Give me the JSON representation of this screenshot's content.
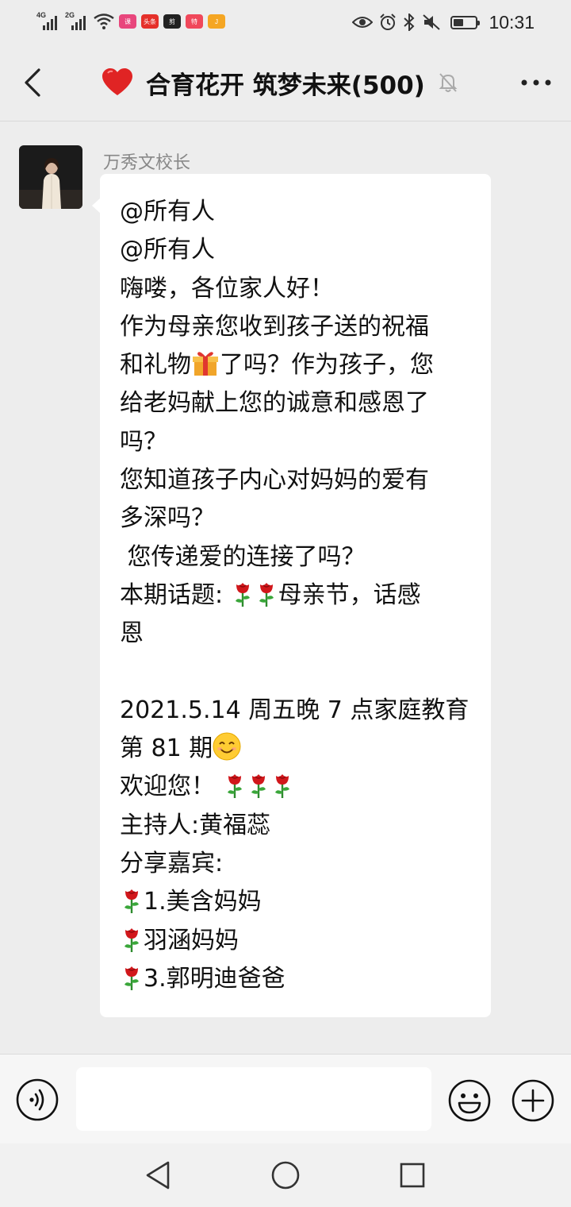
{
  "status_bar": {
    "net1": "4G",
    "net2": "2G",
    "app_badges": [
      {
        "label": "课",
        "color": "#e8467c"
      },
      {
        "label": "头条",
        "color": "#e5302a"
      },
      {
        "label": "剪",
        "color": "#222222"
      },
      {
        "label": "特",
        "color": "#f0485b"
      },
      {
        "label": "J",
        "color": "#f5a623"
      }
    ],
    "battery_level": 0.45,
    "time": "10:31"
  },
  "header": {
    "title": "合育花开 筑梦未来(500)",
    "back_icon": "chevron-left-icon",
    "mute_icon": "bell-off-icon",
    "more_icon": "more-dots-icon"
  },
  "message": {
    "sender": "万秀文校长",
    "avatar_icon": "avatar-photo",
    "lines": [
      "@所有人",
      "@所有人",
      "嗨喽，各位家人好！",
      "作为母亲您收到孩子送的祝福",
      "和礼物🎁了吗？作为孩子，您",
      "给老妈献上您的诚意和感恩了",
      "吗？",
      "您知道孩子内心对妈妈的爱有",
      "多深吗？",
      " 您传递爱的连接了吗？",
      "本期话题: 🌹🌹母亲节，话感",
      "恩",
      "",
      "2021.5.14 周五晚 7 点家庭教育",
      "第 81 期😊",
      "欢迎您！ 🌹🌹🌹",
      "主持人:黄福蕊",
      "分享嘉宾:",
      "🌹1.美含妈妈",
      "🌹羽涵妈妈",
      "🌹3.郭明迪爸爸"
    ]
  },
  "input_bar": {
    "voice_icon": "voice-icon",
    "emoji_icon": "emoji-icon",
    "plus_icon": "plus-circle-icon",
    "input_value": ""
  },
  "nav_bar": {
    "back": "nav-back-icon",
    "home": "nav-home-icon",
    "recent": "nav-recent-icon"
  },
  "colors": {
    "background": "#ededed",
    "bubble": "#ffffff",
    "heart": "#e02424"
  }
}
